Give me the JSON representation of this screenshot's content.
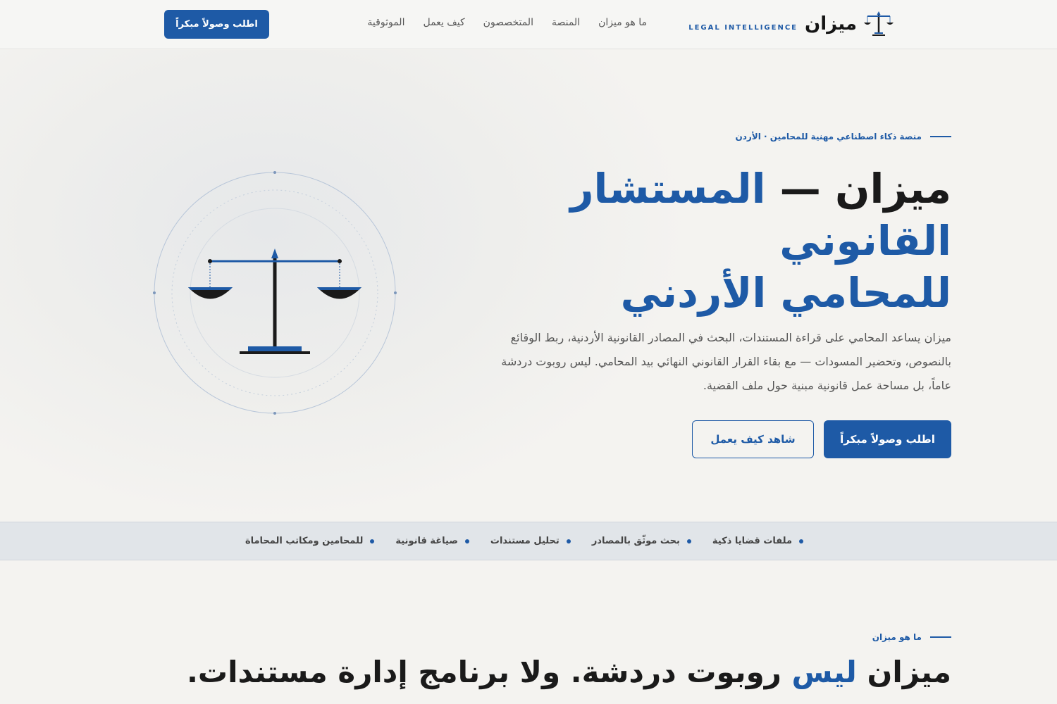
{
  "header": {
    "logo_name": "ميزان",
    "logo_tag": "LEGAL INTELLIGENCE",
    "nav": [
      "ما هو ميزان",
      "المنصة",
      "المتخصصون",
      "كيف يعمل",
      "الموثوقية"
    ],
    "cta": "اطلب وصولاً مبكراً"
  },
  "hero": {
    "eyebrow": "منصة ذكاء اصطناعي مهنية للمحامين · الأردن",
    "title_part1": "ميزان — ",
    "title_part2": "المستشار القانوني",
    "title_part3": "للمحامي الأردني",
    "description": "ميزان يساعد المحامي على قراءة المستندات، البحث في المصادر القانونية الأردنية، ربط الوقائع بالنصوص، وتحضير المسودات — مع بقاء القرار القانوني النهائي بيد المحامي. ليس روبوت دردشة عاماً، بل مساحة عمل قانونية مبنية حول ملف القضية.",
    "primary_cta": "اطلب وصولاً مبكراً",
    "secondary_cta": "شاهد كيف يعمل"
  },
  "strip": {
    "items": [
      "ملفات قضايا ذكية",
      "بحث موثّق بالمصادر",
      "تحليل مستندات",
      "صياغة قانونية",
      "للمحامين ومكاتب المحاماة"
    ]
  },
  "about": {
    "eyebrow": "ما هو ميزان",
    "title_part1": "ميزان ",
    "title_part2": "ليس",
    "title_part3": " روبوت دردشة. ولا برنامج إدارة مستندات."
  },
  "colors": {
    "accent": "#1e5aa6",
    "background": "#f4f3f0",
    "text": "#1a1a1a"
  },
  "icons": {
    "logo": "scales-of-justice-icon",
    "hero_illustration": "scales-of-justice-icon"
  }
}
